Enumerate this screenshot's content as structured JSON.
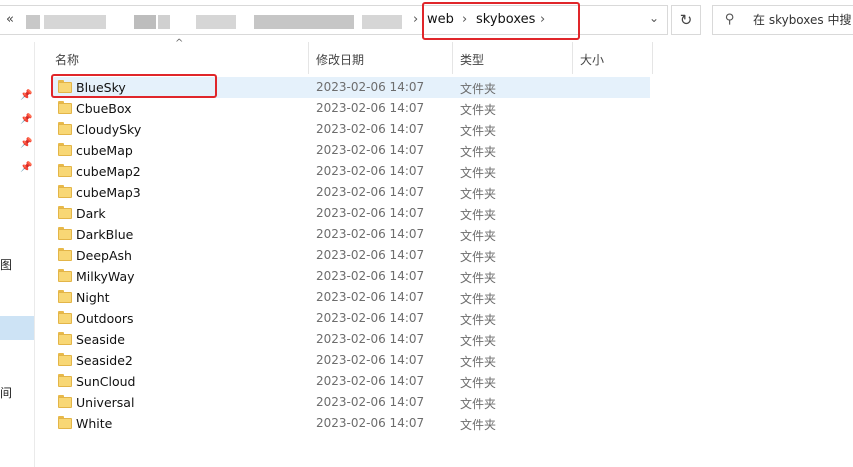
{
  "address_bar": {
    "back_chevron": "«",
    "crumbs": [
      "web",
      "skyboxes"
    ],
    "separator": "›",
    "dropdown_icon": "chevron-down-icon"
  },
  "refresh_icon": "refresh-icon",
  "search": {
    "placeholder": "在 skyboxes 中搜",
    "icon": "search-icon"
  },
  "nav": {
    "label_1": "图",
    "label_2": "空间"
  },
  "columns": {
    "name": "名称",
    "date": "修改日期",
    "type": "类型",
    "size": "大小"
  },
  "files": [
    {
      "name": "BlueSky",
      "date": "2023-02-06 14:07",
      "type": "文件夹"
    },
    {
      "name": "CbueBox",
      "date": "2023-02-06 14:07",
      "type": "文件夹"
    },
    {
      "name": "CloudySky",
      "date": "2023-02-06 14:07",
      "type": "文件夹"
    },
    {
      "name": "cubeMap",
      "date": "2023-02-06 14:07",
      "type": "文件夹"
    },
    {
      "name": "cubeMap2",
      "date": "2023-02-06 14:07",
      "type": "文件夹"
    },
    {
      "name": "cubeMap3",
      "date": "2023-02-06 14:07",
      "type": "文件夹"
    },
    {
      "name": "Dark",
      "date": "2023-02-06 14:07",
      "type": "文件夹"
    },
    {
      "name": "DarkBlue",
      "date": "2023-02-06 14:07",
      "type": "文件夹"
    },
    {
      "name": "DeepAsh",
      "date": "2023-02-06 14:07",
      "type": "文件夹"
    },
    {
      "name": "MilkyWay",
      "date": "2023-02-06 14:07",
      "type": "文件夹"
    },
    {
      "name": "Night",
      "date": "2023-02-06 14:07",
      "type": "文件夹"
    },
    {
      "name": "Outdoors",
      "date": "2023-02-06 14:07",
      "type": "文件夹"
    },
    {
      "name": "Seaside",
      "date": "2023-02-06 14:07",
      "type": "文件夹"
    },
    {
      "name": "Seaside2",
      "date": "2023-02-06 14:07",
      "type": "文件夹"
    },
    {
      "name": "SunCloud",
      "date": "2023-02-06 14:07",
      "type": "文件夹"
    },
    {
      "name": "Universal",
      "date": "2023-02-06 14:07",
      "type": "文件夹"
    },
    {
      "name": "White",
      "date": "2023-02-06 14:07",
      "type": "文件夹"
    }
  ],
  "colors": {
    "highlight_box": "#e0262a",
    "selected_row": "#e5f1fb",
    "folder": "#f8d775"
  }
}
